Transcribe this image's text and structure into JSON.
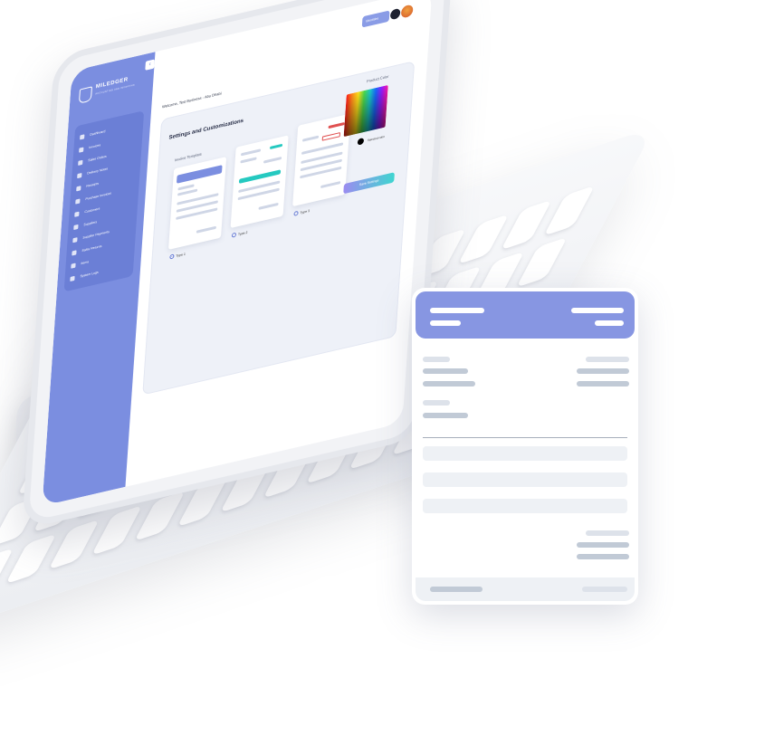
{
  "app": {
    "brand_name": "MILEDGER",
    "brand_tagline": "ACCOUNTING AND INVOICING",
    "collapse_icon": "chevron-left-icon"
  },
  "sidebar": {
    "items": [
      {
        "label": "Dashboard",
        "icon": "dashboard-icon"
      },
      {
        "label": "Invoices",
        "icon": "invoice-icon"
      },
      {
        "label": "Sales Orders",
        "icon": "sales-order-icon"
      },
      {
        "label": "Delivery Notes",
        "icon": "delivery-icon"
      },
      {
        "label": "Receipts",
        "icon": "receipt-icon"
      },
      {
        "label": "Purchase Invoices",
        "icon": "purchase-icon"
      },
      {
        "label": "Customers",
        "icon": "customers-icon"
      },
      {
        "label": "Suppliers",
        "icon": "suppliers-icon"
      },
      {
        "label": "Supplier Payments",
        "icon": "payments-icon"
      },
      {
        "label": "Sales Returns",
        "icon": "returns-icon"
      },
      {
        "label": "Items",
        "icon": "items-icon"
      },
      {
        "label": "System Logs",
        "icon": "logs-icon"
      }
    ]
  },
  "topbar": {
    "action_label": "Identities",
    "welcome": "Welcome, Test Business - Abu Dhabi"
  },
  "settings": {
    "title": "Settings and Customizations",
    "templates_label": "Invoice Template",
    "picker_label": "Product Color",
    "selected_color_label": "Selected color",
    "save_label": "Save Settings",
    "template_options": [
      {
        "label": "Type 1",
        "selected": true
      },
      {
        "label": "Type 2",
        "selected": false
      },
      {
        "label": "Type 3",
        "selected": false
      }
    ],
    "selected_color": "#000000",
    "accent_color": "#7b8ee0"
  }
}
